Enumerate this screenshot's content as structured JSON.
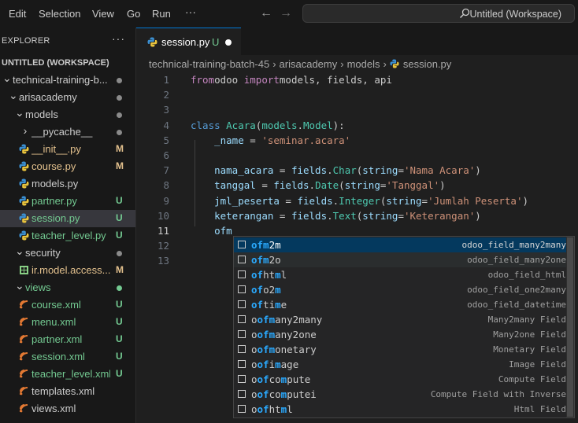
{
  "menu": [
    "Edit",
    "Selection",
    "View",
    "Go",
    "Run",
    "···"
  ],
  "nav": {
    "back": "←",
    "forward": "→"
  },
  "search": {
    "text": "Untitled (Workspace)"
  },
  "sidebar": {
    "title": "EXPLORER",
    "more": "···",
    "workspace": "UNTITLED (WORKSPACE)",
    "items": [
      {
        "label": "technical-training-b...",
        "type": "folder",
        "open": true,
        "indent": 0,
        "marker": "dot",
        "color": "#cccccc"
      },
      {
        "label": "arisacademy",
        "type": "folder",
        "open": true,
        "indent": 1,
        "marker": "dot",
        "color": "#cccccc"
      },
      {
        "label": "models",
        "type": "folder",
        "open": true,
        "indent": 2,
        "marker": "dot",
        "color": "#cccccc"
      },
      {
        "label": "__pycache__",
        "type": "folder",
        "open": false,
        "indent": 3,
        "marker": "dot",
        "color": "#cccccc"
      },
      {
        "label": "__init__.py",
        "type": "python",
        "indent": 3,
        "marker": "M",
        "color": "#e2c08d"
      },
      {
        "label": "course.py",
        "type": "python",
        "indent": 3,
        "marker": "M",
        "color": "#e2c08d"
      },
      {
        "label": "models.py",
        "type": "python",
        "indent": 3,
        "marker": "",
        "color": "#cccccc"
      },
      {
        "label": "partner.py",
        "type": "python",
        "indent": 3,
        "marker": "U",
        "color": "#73c991"
      },
      {
        "label": "session.py",
        "type": "python",
        "indent": 3,
        "marker": "U",
        "color": "#73c991",
        "selected": true
      },
      {
        "label": "teacher_level.py",
        "type": "python",
        "indent": 3,
        "marker": "U",
        "color": "#73c991"
      },
      {
        "label": "security",
        "type": "folder",
        "open": true,
        "indent": 2,
        "marker": "dot",
        "color": "#cccccc"
      },
      {
        "label": "ir.model.access....",
        "type": "csv",
        "indent": 3,
        "marker": "M",
        "color": "#e2c08d"
      },
      {
        "label": "views",
        "type": "folder",
        "open": true,
        "indent": 2,
        "marker": "dot",
        "color": "#73c991"
      },
      {
        "label": "course.xml",
        "type": "xml",
        "indent": 3,
        "marker": "U",
        "color": "#73c991"
      },
      {
        "label": "menu.xml",
        "type": "xml",
        "indent": 3,
        "marker": "U",
        "color": "#73c991"
      },
      {
        "label": "partner.xml",
        "type": "xml",
        "indent": 3,
        "marker": "U",
        "color": "#73c991"
      },
      {
        "label": "session.xml",
        "type": "xml",
        "indent": 3,
        "marker": "U",
        "color": "#73c991"
      },
      {
        "label": "teacher_level.xml",
        "type": "xml",
        "indent": 3,
        "marker": "U",
        "color": "#73c991"
      },
      {
        "label": "templates.xml",
        "type": "xml",
        "indent": 3,
        "marker": "",
        "color": "#cccccc"
      },
      {
        "label": "views.xml",
        "type": "xml",
        "indent": 3,
        "marker": "",
        "color": "#cccccc"
      }
    ]
  },
  "tab": {
    "label": "session.py",
    "status": "U"
  },
  "breadcrumb": [
    "technical-training-batch-45",
    "arisacademy",
    "models",
    "session.py"
  ],
  "editor": {
    "active_line": 11,
    "lines": [
      [
        [
          "kw",
          "from"
        ],
        [
          "",
          "odoo "
        ],
        [
          "kw",
          "import"
        ],
        [
          "",
          "models, fields, api"
        ]
      ],
      [],
      [],
      [
        [
          "kb",
          "class "
        ],
        [
          "cls",
          "Acara"
        ],
        [
          "",
          "("
        ],
        [
          "cls",
          "models"
        ],
        [
          "",
          "."
        ],
        [
          "cls",
          "Model"
        ],
        [
          "",
          "):"
        ]
      ],
      [
        [
          "",
          "    "
        ],
        [
          "var",
          "_name"
        ],
        [
          "",
          " = "
        ],
        [
          "str",
          "'seminar.acara'"
        ]
      ],
      [],
      [
        [
          "",
          "    "
        ],
        [
          "var",
          "nama_acara"
        ],
        [
          "",
          " = "
        ],
        [
          "var",
          "fields"
        ],
        [
          "",
          "."
        ],
        [
          "cls",
          "Char"
        ],
        [
          "",
          "("
        ],
        [
          "var",
          "string"
        ],
        [
          "",
          "="
        ],
        [
          "str",
          "'Nama Acara'"
        ],
        [
          "",
          ")"
        ]
      ],
      [
        [
          "",
          "    "
        ],
        [
          "var",
          "tanggal"
        ],
        [
          "",
          " = "
        ],
        [
          "var",
          "fields"
        ],
        [
          "",
          "."
        ],
        [
          "cls",
          "Date"
        ],
        [
          "",
          "("
        ],
        [
          "var",
          "string"
        ],
        [
          "",
          "="
        ],
        [
          "str",
          "'Tanggal'"
        ],
        [
          "",
          ")"
        ]
      ],
      [
        [
          "",
          "    "
        ],
        [
          "var",
          "jml_peserta"
        ],
        [
          "",
          " = "
        ],
        [
          "var",
          "fields"
        ],
        [
          "",
          "."
        ],
        [
          "cls",
          "Integer"
        ],
        [
          "",
          "("
        ],
        [
          "var",
          "string"
        ],
        [
          "",
          "="
        ],
        [
          "str",
          "'Jumlah Peserta'"
        ],
        [
          "",
          ")"
        ]
      ],
      [
        [
          "",
          "    "
        ],
        [
          "var",
          "keterangan"
        ],
        [
          "",
          " = "
        ],
        [
          "var",
          "fields"
        ],
        [
          "",
          "."
        ],
        [
          "cls",
          "Text"
        ],
        [
          "",
          "("
        ],
        [
          "var",
          "string"
        ],
        [
          "",
          "="
        ],
        [
          "str",
          "'Keterangan'"
        ],
        [
          "",
          ")"
        ]
      ],
      [
        [
          "",
          "    "
        ],
        [
          "var",
          "ofm"
        ]
      ],
      [],
      []
    ]
  },
  "suggestions": [
    {
      "parts": [
        [
          "m",
          "ofm"
        ],
        [
          "",
          "2m"
        ]
      ],
      "detail": "odoo_field_many2many",
      "state": "selected"
    },
    {
      "parts": [
        [
          "m",
          "ofm"
        ],
        [
          "",
          "2o"
        ]
      ],
      "detail": "odoo_field_many2one",
      "state": "hover"
    },
    {
      "parts": [
        [
          "m",
          "of"
        ],
        [
          "",
          "ht"
        ],
        [
          "m",
          "m"
        ],
        [
          "",
          "l"
        ]
      ],
      "detail": "odoo_field_html",
      "state": ""
    },
    {
      "parts": [
        [
          "m",
          "of"
        ],
        [
          "",
          "o2"
        ],
        [
          "m",
          "m"
        ]
      ],
      "detail": "odoo_field_one2many",
      "state": ""
    },
    {
      "parts": [
        [
          "m",
          "of"
        ],
        [
          "",
          "ti"
        ],
        [
          "m",
          "m"
        ],
        [
          "",
          "e"
        ]
      ],
      "detail": "odoo_field_datetime",
      "state": ""
    },
    {
      "parts": [
        [
          "",
          "o"
        ],
        [
          "m",
          "ofm"
        ],
        [
          "",
          "any2many"
        ]
      ],
      "detail": "Many2many Field",
      "state": ""
    },
    {
      "parts": [
        [
          "",
          "o"
        ],
        [
          "m",
          "ofm"
        ],
        [
          "",
          "any2one"
        ]
      ],
      "detail": "Many2one Field",
      "state": ""
    },
    {
      "parts": [
        [
          "",
          "o"
        ],
        [
          "m",
          "ofm"
        ],
        [
          "",
          "onetary"
        ]
      ],
      "detail": "Monetary Field",
      "state": ""
    },
    {
      "parts": [
        [
          "",
          "o"
        ],
        [
          "m",
          "of"
        ],
        [
          "",
          "i"
        ],
        [
          "m",
          "m"
        ],
        [
          "",
          "age"
        ]
      ],
      "detail": "Image Field",
      "state": ""
    },
    {
      "parts": [
        [
          "",
          "o"
        ],
        [
          "m",
          "of"
        ],
        [
          "",
          "co"
        ],
        [
          "m",
          "m"
        ],
        [
          "",
          "pute"
        ]
      ],
      "detail": "Compute Field",
      "state": ""
    },
    {
      "parts": [
        [
          "",
          "o"
        ],
        [
          "m",
          "of"
        ],
        [
          "",
          "co"
        ],
        [
          "m",
          "m"
        ],
        [
          "",
          "putei"
        ]
      ],
      "detail": "Compute Field with Inverse",
      "state": ""
    },
    {
      "parts": [
        [
          "",
          "o"
        ],
        [
          "m",
          "of"
        ],
        [
          "",
          "ht"
        ],
        [
          "m",
          "m"
        ],
        [
          "",
          "l"
        ]
      ],
      "detail": "Html Field",
      "state": ""
    }
  ]
}
